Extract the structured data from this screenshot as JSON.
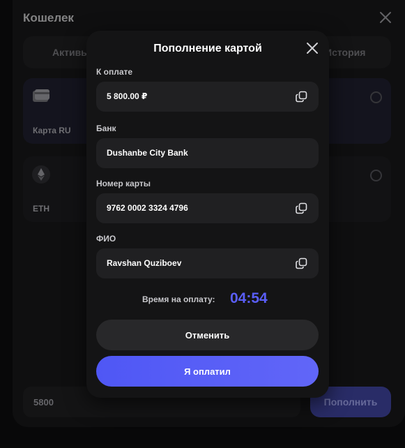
{
  "wallet": {
    "title": "Кошелек",
    "tabs": [
      {
        "label": "Активы"
      },
      {
        "label": "История"
      }
    ],
    "methods": [
      {
        "label": "Карта RU",
        "icon": "card-icon"
      },
      {
        "label": "ETH",
        "icon": "ethereum-icon"
      }
    ],
    "amount_value": "5800",
    "topup_label": "Пополнить"
  },
  "modal": {
    "title": "Пополнение картой",
    "fields": [
      {
        "label": "К оплате",
        "value": "5 800.00 ₽",
        "copyable": true
      },
      {
        "label": "Банк",
        "value": "Dushanbe City Bank",
        "copyable": false
      },
      {
        "label": "Номер карты",
        "value": "9762 0002 3324 4796",
        "copyable": true
      },
      {
        "label": "ФИО",
        "value": "Ravshan Quziboev",
        "copyable": true
      }
    ],
    "timer_label": "Время на оплату:",
    "timer_value": "04:54",
    "cancel_label": "Отменить",
    "paid_label": "Я оплатил"
  },
  "colors": {
    "accent": "#5a5ef7",
    "modal_bg": "#141415",
    "field_bg": "#202022",
    "topup_bg": "#3a3e8f"
  }
}
